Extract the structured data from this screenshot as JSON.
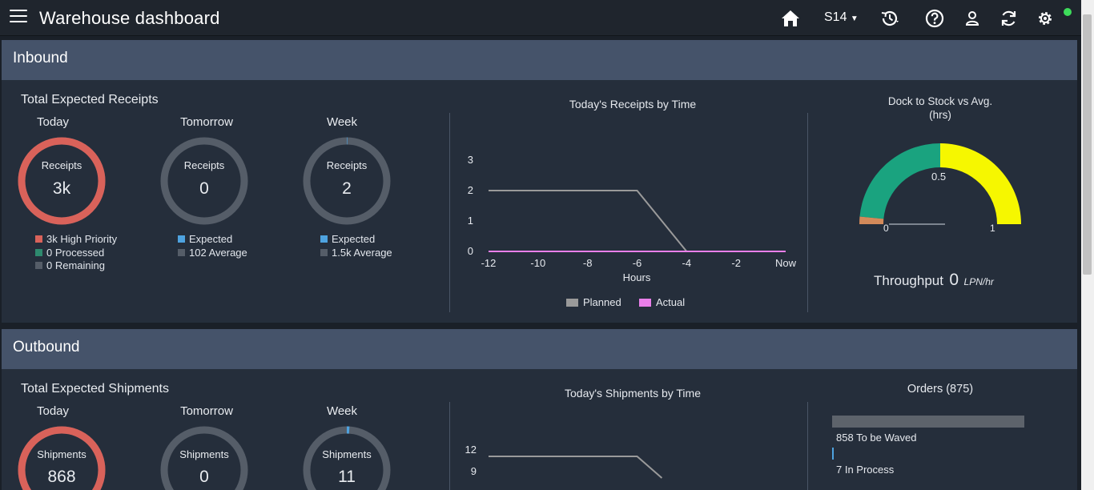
{
  "app": {
    "title": "Warehouse dashboard",
    "store": "S14",
    "icons": [
      "menu-icon",
      "home-icon",
      "history-icon",
      "help-icon",
      "user-icon",
      "refresh-icon",
      "gear-icon"
    ],
    "status_color": "#3ddc5a"
  },
  "colors": {
    "high_priority": "#d9625a",
    "processed": "#2e8a6e",
    "remaining": "#555d68",
    "expected": "#4ea3e0",
    "average": "#555d68",
    "planned": "#9a9a9a",
    "actual": "#e97fe9",
    "gauge_green": "#1aa37f",
    "gauge_yellow": "#f6f700",
    "gauge_orange": "#d38a5a"
  },
  "inbound": {
    "header": "Inbound",
    "section_title": "Total Expected Receipts",
    "columns": [
      {
        "label": "Today",
        "ring_label": "Receipts",
        "value": "3k",
        "fill": 1.0,
        "legend": [
          {
            "color": "#d9625a",
            "text": "3k High Priority"
          },
          {
            "color": "#2e8a6e",
            "text": "0 Processed"
          },
          {
            "color": "#555d68",
            "text": "0 Remaining"
          }
        ]
      },
      {
        "label": "Tomorrow",
        "ring_label": "Receipts",
        "value": "0",
        "fill": 0,
        "legend": [
          {
            "color": "#4ea3e0",
            "text": "Expected"
          },
          {
            "color": "#555d68",
            "text": "102 Average"
          }
        ]
      },
      {
        "label": "Week",
        "ring_label": "Receipts",
        "value": "2",
        "fill": 0.002,
        "legend": [
          {
            "color": "#4ea3e0",
            "text": "Expected"
          },
          {
            "color": "#555d68",
            "text": "1.5k Average"
          }
        ]
      }
    ],
    "chart": {
      "title": "Today's Receipts by Time",
      "xlabel": "Hours",
      "x_ticks": [
        "-12",
        "-10",
        "-8",
        "-6",
        "-4",
        "-2",
        "Now"
      ],
      "y_ticks": [
        "0",
        "1",
        "2",
        "3"
      ],
      "legend": [
        "Planned",
        "Actual"
      ]
    },
    "gauge": {
      "title_line1": "Dock to Stock vs Avg.",
      "title_line2": "(hrs)",
      "min_label": "0",
      "mid_label": "0.5",
      "max_label": "1",
      "throughput_label": "Throughput",
      "throughput_value": "0",
      "throughput_unit": "LPN/hr"
    }
  },
  "outbound": {
    "header": "Outbound",
    "section_title": "Total Expected Shipments",
    "columns": [
      {
        "label": "Today",
        "ring_label": "Shipments",
        "value": "868",
        "fill": 1.0
      },
      {
        "label": "Tomorrow",
        "ring_label": "Shipments",
        "value": "0",
        "fill": 0
      },
      {
        "label": "Week",
        "ring_label": "Shipments",
        "value": "11",
        "fill": 0.01
      }
    ],
    "chart": {
      "title": "Today's Shipments by Time",
      "y_ticks": [
        "12",
        "9"
      ]
    },
    "orders": {
      "title": "Orders (875)",
      "items": [
        {
          "text": "858 To be Waved",
          "fraction": 0.98
        },
        {
          "text": "7 In Process",
          "fraction": 0.008
        }
      ]
    }
  },
  "chart_data": [
    {
      "type": "line",
      "title": "Today's Receipts by Time",
      "xlabel": "Hours",
      "ylabel": "",
      "x": [
        -12,
        -10,
        -8,
        -6,
        -4,
        -2,
        0
      ],
      "x_tick_labels": [
        "-12",
        "-10",
        "-8",
        "-6",
        "-4",
        "-2",
        "Now"
      ],
      "xlim": [
        -12,
        0
      ],
      "ylim": [
        0,
        3
      ],
      "series": [
        {
          "name": "Planned",
          "color": "#9a9a9a",
          "values": [
            2,
            2,
            2,
            2,
            0,
            0,
            0
          ]
        },
        {
          "name": "Actual",
          "color": "#e97fe9",
          "values": [
            0,
            0,
            0,
            0,
            0,
            0,
            0
          ]
        }
      ],
      "legend": "bottom"
    },
    {
      "type": "line",
      "title": "Today's Shipments by Time",
      "x": [
        -12,
        -10,
        -8,
        -6,
        -5
      ],
      "ylim": [
        0,
        12
      ],
      "series": [
        {
          "color": "#9a9a9a",
          "values": [
            12,
            12,
            12,
            12,
            9
          ]
        }
      ]
    }
  ]
}
